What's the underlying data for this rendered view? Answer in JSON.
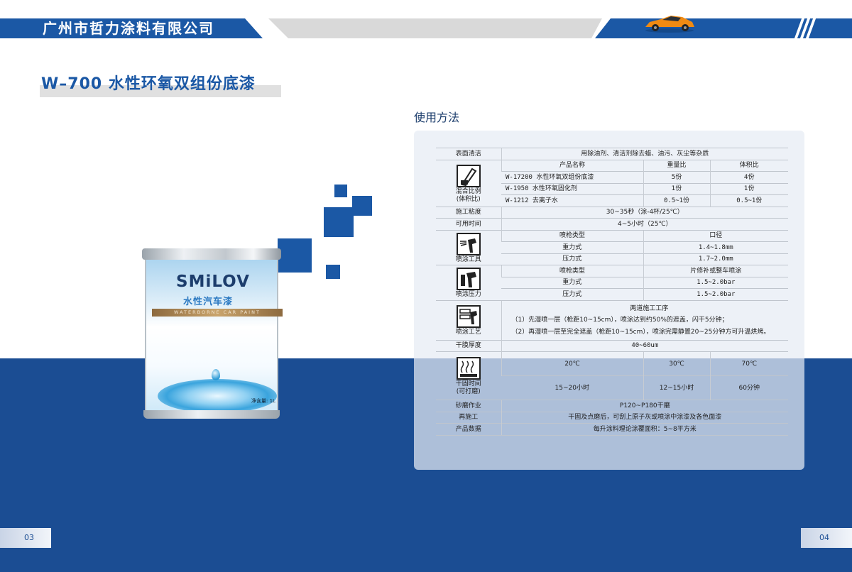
{
  "header": {
    "company": "广州市哲力涂料有限公司"
  },
  "product": {
    "title": "W–700  水性环氧双组份底漆"
  },
  "can": {
    "brand": "SMiLOV",
    "brand_cn": "水性汽车漆",
    "band_text": "WATERBORNE CAR PAINT",
    "net": "净含量: 1L"
  },
  "usage": {
    "title": "使用方法",
    "surface": {
      "label": "表面清洁",
      "value": "用除油剂、清洁剂除去蜡、油污、灰尘等杂质"
    },
    "mixing": {
      "label": "混合比例\n(体积比)",
      "headers": [
        "产品名称",
        "重量比",
        "体积比"
      ],
      "rows": [
        [
          "W-17200  水性环氧双组份底漆",
          "5份",
          "4份"
        ],
        [
          "W-1950  水性环氧固化剂",
          "1份",
          "1份"
        ],
        [
          "W-1212  去离子水",
          "0.5~1份",
          "0.5~1份"
        ]
      ]
    },
    "viscosity": {
      "label": "施工粘度",
      "value": "30~35秒（涂-4杯/25℃）"
    },
    "pot_life": {
      "label": "可用时间",
      "value": "4~5小时（25℃）"
    },
    "spray_tool": {
      "label": "喷涂工具",
      "headers": [
        "喷枪类型",
        "口径"
      ],
      "rows": [
        [
          "重力式",
          "1.4~1.8mm"
        ],
        [
          "压力式",
          "1.7~2.0mm"
        ]
      ]
    },
    "spray_pressure": {
      "label": "喷涂压力",
      "headers": [
        "喷枪类型",
        "片修补或整车喷涂"
      ],
      "rows": [
        [
          "重力式",
          "1.5~2.0bar"
        ],
        [
          "压力式",
          "1.5~2.0bar"
        ]
      ]
    },
    "process": {
      "label": "喷涂工艺",
      "heading": "两道施工工序",
      "steps": [
        "（1）先湿喷一层（枪距10~15cm），喷涂达到约50%的遮盖，闪干5分钟；",
        "（2）再湿喷一层至完全遮盖（枪距10~15cm），喷涂完需静置20~25分钟方可升温烘烤。"
      ]
    },
    "film": {
      "label": "干膜厚度",
      "value": "40~60um"
    },
    "drying": {
      "label": "干固时间\n(可打磨)",
      "temps": [
        "20℃",
        "30℃",
        "70℃"
      ],
      "times": [
        "15~20小时",
        "12~15小时",
        "60分钟"
      ]
    },
    "sanding": {
      "label": "砂磨作业",
      "value": "P120~P180干磨"
    },
    "recoat": {
      "label": "再施工",
      "value": "干固及点磨后，可刮上原子灰或喷涂中涂漆及各色面漆"
    },
    "product_data": {
      "label": "产品数据",
      "value": "每升涂料理论涂覆面积：5~8平方米"
    }
  },
  "pages": {
    "left": "03",
    "right": "04"
  },
  "icons": [
    "mixing-stick-icon",
    "spray-gun-icon",
    "spray-gun-pressure-icon",
    "spray-process-icon",
    "drying-heat-icon"
  ]
}
